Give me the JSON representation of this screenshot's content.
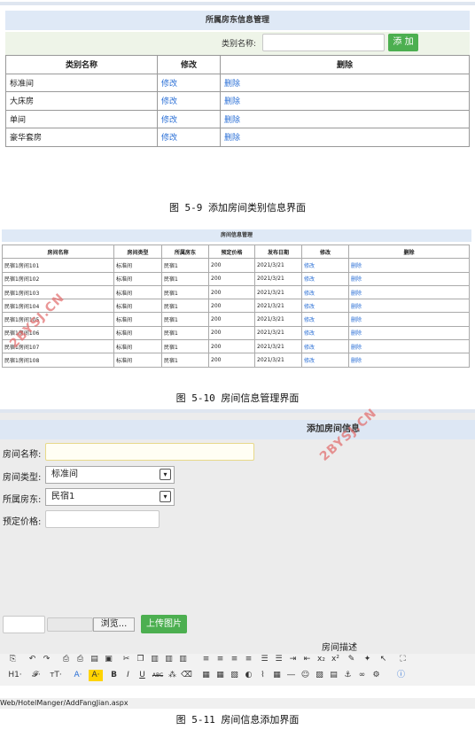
{
  "category_page": {
    "title": "所属房东信息管理",
    "form_label": "类别名称:",
    "add_button": "添 加",
    "columns": [
      "类别名称",
      "修改",
      "删除"
    ],
    "rows": [
      [
        "标准间",
        "修改",
        "删除"
      ],
      [
        "大床房",
        "修改",
        "删除"
      ],
      [
        "单间",
        "修改",
        "删除"
      ],
      [
        "豪华套房",
        "修改",
        "删除"
      ]
    ],
    "caption": "图 5-9 添加房间类别信息界面"
  },
  "room_page": {
    "title": "房间信息管理",
    "columns": [
      "房间名称",
      "房间类型",
      "所属房东",
      "预定价格",
      "发布日期",
      "修改",
      "删除"
    ],
    "rows": [
      [
        "民宿1房间101",
        "标准间",
        "民宿1",
        "200",
        "2021/3/21",
        "修改",
        "删除"
      ],
      [
        "民宿1房间102",
        "标准间",
        "民宿1",
        "200",
        "2021/3/21",
        "修改",
        "删除"
      ],
      [
        "民宿1房间103",
        "标准间",
        "民宿1",
        "200",
        "2021/3/21",
        "修改",
        "删除"
      ],
      [
        "民宿1房间104",
        "标准间",
        "民宿1",
        "200",
        "2021/3/21",
        "修改",
        "删除"
      ],
      [
        "民宿1房间105",
        "标准间",
        "民宿1",
        "200",
        "2021/3/21",
        "修改",
        "删除"
      ],
      [
        "民宿1房间106",
        "标准间",
        "民宿1",
        "200",
        "2021/3/21",
        "修改",
        "删除"
      ],
      [
        "民宿1房间107",
        "标准间",
        "民宿1",
        "200",
        "2021/3/21",
        "修改",
        "删除"
      ],
      [
        "民宿1房间108",
        "标准间",
        "民宿1",
        "200",
        "2021/3/21",
        "修改",
        "删除"
      ]
    ],
    "caption": "图 5-10 房间信息管理界面"
  },
  "add_room_page": {
    "title": "添加房间信息",
    "room_name_label": "房间名称:",
    "room_type_label": "房间类型:",
    "room_type_value": "标准间",
    "landlord_label": "所属房东:",
    "landlord_value": "民宿1",
    "price_label": "预定价格:",
    "browse_button": "浏览...",
    "upload_button": "上传图片",
    "description_label": "房间描述",
    "toolbar_row2_labels": [
      "H1·",
      "𝓕·",
      "тT·",
      "A·",
      "A·",
      "B",
      "I",
      "U",
      "ABC"
    ],
    "status_url": "Web/HotelManger/AddFangJian.aspx",
    "caption": "图 5-11 房间信息添加界面"
  },
  "watermark": "2BYSJ.CN",
  "colors": {
    "title_bar": "#dfe9f6",
    "add_button": "#4caf50",
    "link": "#2a6fd6",
    "watermark": "#e26a6a"
  }
}
